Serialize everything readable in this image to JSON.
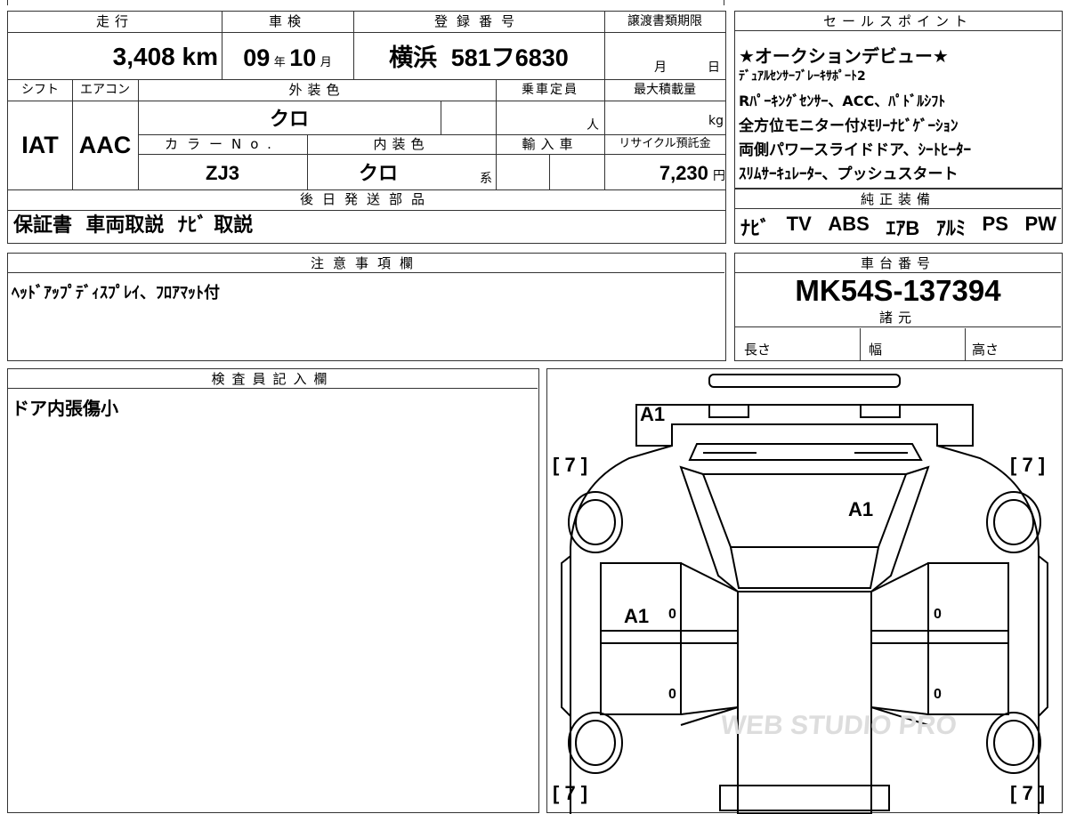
{
  "top_table": {
    "headers": {
      "mileage": "走行",
      "inspection": "車検",
      "reg_number": "登録番号",
      "transfer_deadline": "譲渡書類期限",
      "shift": "シフト",
      "aircon": "エアコン",
      "exterior_color": "外装色",
      "capacity": "乗車定員",
      "max_load": "最大積載量",
      "color_no": "カラーNo.",
      "interior_color": "内装色",
      "import": "輸入車",
      "recycle": "リサイクル預託金",
      "later_items": "後日発送部品"
    },
    "mileage_value": "3,408",
    "mileage_unit": "km",
    "inspection_year": "09",
    "year_unit": "年",
    "inspection_month": "10",
    "month_unit": "月",
    "reg_city": "横浜",
    "reg_class": "581",
    "reg_kana": "フ",
    "reg_num": "6830",
    "deadline_month_unit": "月",
    "deadline_day_unit": "日",
    "shift_value": "IAT",
    "aircon_value": "AAC",
    "exterior_value": "クロ",
    "capacity_unit": "人",
    "max_load_unit": "kg",
    "color_no_value": "ZJ3",
    "interior_value": "クロ",
    "interior_suffix": "系",
    "recycle_value": "7,230",
    "recycle_unit": "円",
    "later_items_value": "保証書  車両取説  ﾅﾋﾞ 取説"
  },
  "sales_points": {
    "header": "セールスポイント",
    "lines": [
      "★オークションデビュー★",
      "ﾃﾞｭｱﾙｾﾝｻｰﾌﾞﾚｰｷｻﾎﾟｰﾄ2",
      "Rﾊﾟｰｷﾝｸﾞｾﾝｻｰ、ACC、ﾊﾟﾄﾞﾙｼﾌﾄ",
      "全方位モニター付ﾒﾓﾘｰﾅﾋﾞｹﾞｰｼｮﾝ",
      "両側パワースライドドア、ｼｰﾄﾋｰﾀｰ",
      "ｽﾘﾑｻｰｷｭﾚｰﾀｰ、プッシュスタート"
    ]
  },
  "equipment": {
    "header": "純正装備",
    "items": [
      "ﾅﾋﾞ",
      "TV",
      "ABS",
      "ｴｱB",
      "ｱﾙﾐ",
      "PS",
      "PW"
    ]
  },
  "notes": {
    "header": "注意事項欄",
    "text": "ﾍｯﾄﾞｱｯﾌﾟﾃﾞｨｽﾌﾟﾚｲ、ﾌﾛｱﾏｯﾄ付"
  },
  "chassis": {
    "header": "車台番号",
    "value": "MK54S-137394",
    "specs_header": "諸元",
    "length_label": "長さ",
    "width_label": "幅",
    "height_label": "高さ"
  },
  "inspector": {
    "header": "検査員記入欄",
    "text": "ドア内張傷小"
  },
  "diagram": {
    "marks": [
      "A1",
      "A1",
      "A1"
    ],
    "tire_marks": [
      "[ 7 ]",
      "[ 7 ]",
      "[ 7 ]",
      "[ 7 ]"
    ],
    "zero_marks": [
      "0",
      "0",
      "0",
      "0"
    ],
    "watermark": "WEB STUDIO PRO"
  }
}
